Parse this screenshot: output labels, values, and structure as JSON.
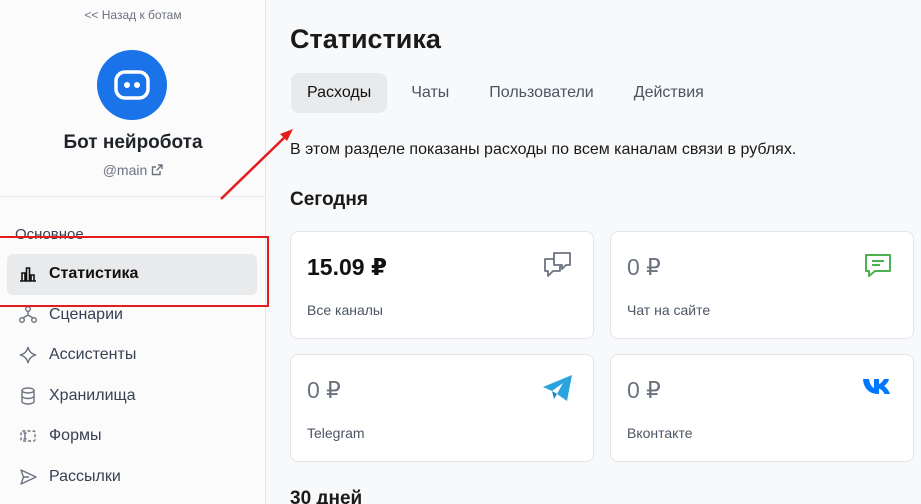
{
  "sidebar": {
    "back_link": "<< Назад к ботам",
    "bot_name": "Бот нейробота",
    "bot_handle": "@main",
    "section_label": "Основное",
    "items": [
      {
        "label": "Статистика",
        "icon": "bar-chart-icon",
        "active": true
      },
      {
        "label": "Сценарии",
        "icon": "flow-icon",
        "active": false
      },
      {
        "label": "Ассистенты",
        "icon": "sparkle-icon",
        "active": false
      },
      {
        "label": "Хранилища",
        "icon": "database-icon",
        "active": false
      },
      {
        "label": "Формы",
        "icon": "form-icon",
        "active": false
      },
      {
        "label": "Рассылки",
        "icon": "send-icon",
        "active": false
      }
    ]
  },
  "main": {
    "title": "Статистика",
    "tabs": [
      {
        "label": "Расходы",
        "active": true
      },
      {
        "label": "Чаты",
        "active": false
      },
      {
        "label": "Пользователи",
        "active": false
      },
      {
        "label": "Действия",
        "active": false
      }
    ],
    "description": "В этом разделе показаны расходы по всем каналам связи в рублях.",
    "today_heading": "Сегодня",
    "cards": [
      {
        "amount": "15.09 ₽",
        "label": "Все каналы",
        "icon": "chat-bubbles-icon"
      },
      {
        "amount": "0 ₽",
        "label": "Чат на сайте",
        "icon": "site-chat-icon"
      },
      {
        "amount": "0 ₽",
        "label": "Telegram",
        "icon": "telegram-icon"
      },
      {
        "amount": "0 ₽",
        "label": "Вконтакте",
        "icon": "vk-icon"
      }
    ],
    "period_heading": "30 дней"
  },
  "colors": {
    "accent": "#1a73e8",
    "annotation_red": "#e41c1c",
    "site_chat_green": "#4caf50",
    "telegram_blue": "#2aa3df",
    "vk_blue": "#0077ff"
  }
}
